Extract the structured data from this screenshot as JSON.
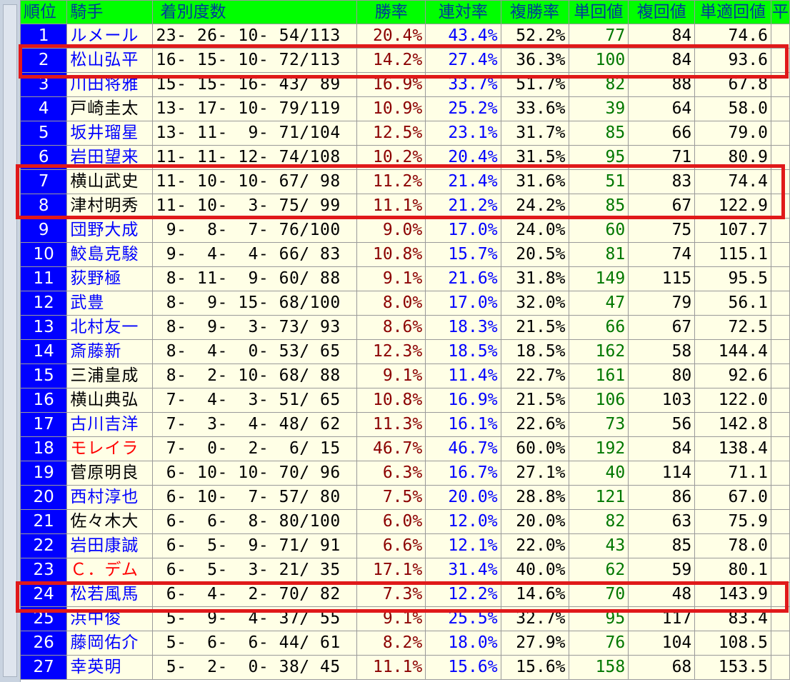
{
  "columns": [
    "順位",
    "騎手",
    "着別度数",
    "勝率",
    "連対率",
    "複勝率",
    "単回値",
    "複回値",
    "単適回値",
    "平"
  ],
  "rows": [
    {
      "rank": "1",
      "name": "ルメール",
      "color": "blue",
      "record": "23- 26- 10- 54/113",
      "win": "20.4%",
      "ren": "43.4%",
      "fuku": "52.2%",
      "tan": "77",
      "fv": "84",
      "tt": "74.6"
    },
    {
      "rank": "2",
      "name": "松山弘平",
      "color": "blue",
      "record": "16- 15- 10- 72/113",
      "win": "14.2%",
      "ren": "27.4%",
      "fuku": "36.3%",
      "tan": "100",
      "fv": "84",
      "tt": "93.6"
    },
    {
      "rank": "3",
      "name": "川田将雅",
      "color": "blue",
      "record": "15- 15- 16- 43/ 89",
      "win": "16.9%",
      "ren": "33.7%",
      "fuku": "51.7%",
      "tan": "82",
      "fv": "88",
      "tt": "67.8"
    },
    {
      "rank": "4",
      "name": "戸崎圭太",
      "color": "black",
      "record": "13- 17- 10- 79/119",
      "win": "10.9%",
      "ren": "25.2%",
      "fuku": "33.6%",
      "tan": "39",
      "fv": "64",
      "tt": "58.0"
    },
    {
      "rank": "5",
      "name": "坂井瑠星",
      "color": "blue",
      "record": "13- 11-  9- 71/104",
      "win": "12.5%",
      "ren": "23.1%",
      "fuku": "31.7%",
      "tan": "85",
      "fv": "66",
      "tt": "79.0"
    },
    {
      "rank": "6",
      "name": "岩田望来",
      "color": "blue",
      "record": "11- 11- 12- 74/108",
      "win": "10.2%",
      "ren": "20.4%",
      "fuku": "31.5%",
      "tan": "95",
      "fv": "71",
      "tt": "80.9"
    },
    {
      "rank": "7",
      "name": "横山武史",
      "color": "black",
      "record": "11- 10- 10- 67/ 98",
      "win": "11.2%",
      "ren": "21.4%",
      "fuku": "31.6%",
      "tan": "51",
      "fv": "83",
      "tt": "74.4"
    },
    {
      "rank": "8",
      "name": "津村明秀",
      "color": "black",
      "record": "11- 10-  3- 75/ 99",
      "win": "11.1%",
      "ren": "21.2%",
      "fuku": "24.2%",
      "tan": "85",
      "fv": "67",
      "tt": "122.9"
    },
    {
      "rank": "9",
      "name": "団野大成",
      "color": "blue",
      "record": " 9-  8-  7- 76/100",
      "win": "9.0%",
      "ren": "17.0%",
      "fuku": "24.0%",
      "tan": "60",
      "fv": "75",
      "tt": "107.7"
    },
    {
      "rank": "10",
      "name": "鮫島克駿",
      "color": "blue",
      "record": " 9-  4-  4- 66/ 83",
      "win": "10.8%",
      "ren": "15.7%",
      "fuku": "20.5%",
      "tan": "81",
      "fv": "74",
      "tt": "115.1"
    },
    {
      "rank": "11",
      "name": "荻野極",
      "color": "blue",
      "record": " 8- 11-  9- 60/ 88",
      "win": "9.1%",
      "ren": "21.6%",
      "fuku": "31.8%",
      "tan": "149",
      "fv": "115",
      "tt": "95.5"
    },
    {
      "rank": "12",
      "name": "武豊",
      "color": "blue",
      "record": " 8-  9- 15- 68/100",
      "win": "8.0%",
      "ren": "17.0%",
      "fuku": "32.0%",
      "tan": "47",
      "fv": "79",
      "tt": "56.1"
    },
    {
      "rank": "13",
      "name": "北村友一",
      "color": "blue",
      "record": " 8-  9-  3- 73/ 93",
      "win": "8.6%",
      "ren": "18.3%",
      "fuku": "21.5%",
      "tan": "66",
      "fv": "67",
      "tt": "72.5"
    },
    {
      "rank": "14",
      "name": "斎藤新",
      "color": "blue",
      "record": " 8-  4-  0- 53/ 65",
      "win": "12.3%",
      "ren": "18.5%",
      "fuku": "18.5%",
      "tan": "162",
      "fv": "58",
      "tt": "144.4"
    },
    {
      "rank": "15",
      "name": "三浦皇成",
      "color": "black",
      "record": " 8-  2- 10- 68/ 88",
      "win": "9.1%",
      "ren": "11.4%",
      "fuku": "22.7%",
      "tan": "161",
      "fv": "80",
      "tt": "92.6"
    },
    {
      "rank": "16",
      "name": "横山典弘",
      "color": "black",
      "record": " 7-  4-  3- 51/ 65",
      "win": "10.8%",
      "ren": "16.9%",
      "fuku": "21.5%",
      "tan": "106",
      "fv": "103",
      "tt": "122.0"
    },
    {
      "rank": "17",
      "name": "古川吉洋",
      "color": "blue",
      "record": " 7-  3-  4- 48/ 62",
      "win": "11.3%",
      "ren": "16.1%",
      "fuku": "22.6%",
      "tan": "73",
      "fv": "56",
      "tt": "142.8"
    },
    {
      "rank": "18",
      "name": "モレイラ",
      "color": "red",
      "record": " 7-  0-  2-  6/ 15",
      "win": "46.7%",
      "ren": "46.7%",
      "fuku": "60.0%",
      "tan": "192",
      "fv": "84",
      "tt": "138.4"
    },
    {
      "rank": "19",
      "name": "菅原明良",
      "color": "black",
      "record": " 6- 10- 10- 70/ 96",
      "win": "6.3%",
      "ren": "16.7%",
      "fuku": "27.1%",
      "tan": "40",
      "fv": "114",
      "tt": "71.1"
    },
    {
      "rank": "20",
      "name": "西村淳也",
      "color": "blue",
      "record": " 6- 10-  7- 57/ 80",
      "win": "7.5%",
      "ren": "20.0%",
      "fuku": "28.8%",
      "tan": "121",
      "fv": "86",
      "tt": "67.0"
    },
    {
      "rank": "21",
      "name": "佐々木大",
      "color": "black",
      "record": " 6-  6-  8- 80/100",
      "win": "6.0%",
      "ren": "12.0%",
      "fuku": "20.0%",
      "tan": "82",
      "fv": "63",
      "tt": "75.9"
    },
    {
      "rank": "22",
      "name": "岩田康誠",
      "color": "blue",
      "record": " 6-  5-  9- 71/ 91",
      "win": "6.6%",
      "ren": "12.1%",
      "fuku": "22.0%",
      "tan": "43",
      "fv": "85",
      "tt": "78.0"
    },
    {
      "rank": "23",
      "name": "Ｃ．デム",
      "color": "red",
      "record": " 6-  5-  3- 21/ 35",
      "win": "17.1%",
      "ren": "31.4%",
      "fuku": "40.0%",
      "tan": "62",
      "fv": "59",
      "tt": "80.1"
    },
    {
      "rank": "24",
      "name": "松若風馬",
      "color": "blue",
      "record": " 6-  4-  2- 70/ 82",
      "win": "7.3%",
      "ren": "12.2%",
      "fuku": "14.6%",
      "tan": "70",
      "fv": "48",
      "tt": "143.9"
    },
    {
      "rank": "25",
      "name": "浜中俊",
      "color": "blue",
      "record": " 5-  9-  4- 37/ 55",
      "win": "9.1%",
      "ren": "25.5%",
      "fuku": "32.7%",
      "tan": "95",
      "fv": "117",
      "tt": "83.4"
    },
    {
      "rank": "26",
      "name": "藤岡佑介",
      "color": "blue",
      "record": " 5-  6-  6- 44/ 61",
      "win": "8.2%",
      "ren": "18.0%",
      "fuku": "27.9%",
      "tan": "76",
      "fv": "104",
      "tt": "108.5"
    },
    {
      "rank": "27",
      "name": "幸英明",
      "color": "blue",
      "record": " 5-  2-  0- 38/ 45",
      "win": "11.1%",
      "ren": "15.6%",
      "fuku": "15.6%",
      "tan": "158",
      "fv": "68",
      "tt": "153.5"
    }
  ],
  "highlight_color": "#e0191a",
  "rank_bg_color": "#0000ff",
  "header_bg_color": "#00ff00"
}
